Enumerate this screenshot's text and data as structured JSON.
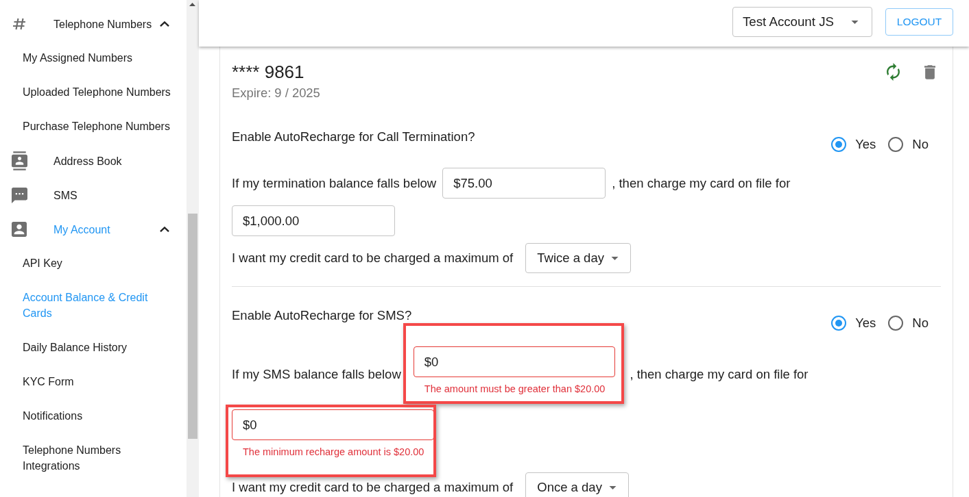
{
  "sidebar": {
    "items": [
      {
        "label": "Telephone Numbers",
        "selected": false,
        "expanded": true,
        "children": [
          {
            "label": "My Assigned Numbers",
            "selected": false
          },
          {
            "label": "Uploaded Telephone Numbers",
            "selected": false
          },
          {
            "label": "Purchase Telephone Numbers",
            "selected": false
          }
        ]
      },
      {
        "label": "Address Book",
        "selected": false
      },
      {
        "label": "SMS",
        "selected": false
      },
      {
        "label": "My Account",
        "selected": true,
        "expanded": true,
        "children": [
          {
            "label": "API Key",
            "selected": false
          },
          {
            "label": "Account Balance & Credit Cards",
            "selected": true
          },
          {
            "label": "Daily Balance History",
            "selected": false
          },
          {
            "label": "KYC Form",
            "selected": false
          },
          {
            "label": "Notifications",
            "selected": false
          },
          {
            "label": "Telephone Numbers Integrations",
            "selected": false
          }
        ]
      }
    ]
  },
  "header": {
    "account_select": {
      "value": "Test Account JS"
    },
    "logout_button": "LOGOUT"
  },
  "card": {
    "number": "**** 9861",
    "expiry": "Expire: 9 / 2025",
    "sections": [
      {
        "question": "Enable AutoRecharge for Call Termination?",
        "options": [
          {
            "label": "Yes",
            "selected": true
          },
          {
            "label": "No",
            "selected": false
          }
        ],
        "threshold_prefix": "If my termination balance falls below",
        "threshold": {
          "value": "$75.00",
          "highlighted": false
        },
        "threshold_suffix": ", then charge my card on file for",
        "recharge_amount": {
          "value": "$1,000.00",
          "highlighted": false
        },
        "frequency_label": "I want my credit card to be charged a maximum of",
        "frequency": {
          "value": "Twice a day"
        }
      },
      {
        "question": "Enable AutoRecharge for SMS?",
        "options": [
          {
            "label": "Yes",
            "selected": true
          },
          {
            "label": "No",
            "selected": false
          }
        ],
        "threshold_prefix": "If my SMS balance falls below",
        "threshold": {
          "value": "$0",
          "error": "The amount must be greater than $20.00",
          "highlighted": true
        },
        "threshold_suffix": ", then charge my card on file for",
        "recharge_amount": {
          "value": "$0",
          "error": "The minimum recharge amount is $20.00",
          "highlighted": true
        },
        "frequency_label": "I want my credit card to be charged a maximum of",
        "frequency": {
          "value": "Once a day"
        }
      }
    ]
  }
}
